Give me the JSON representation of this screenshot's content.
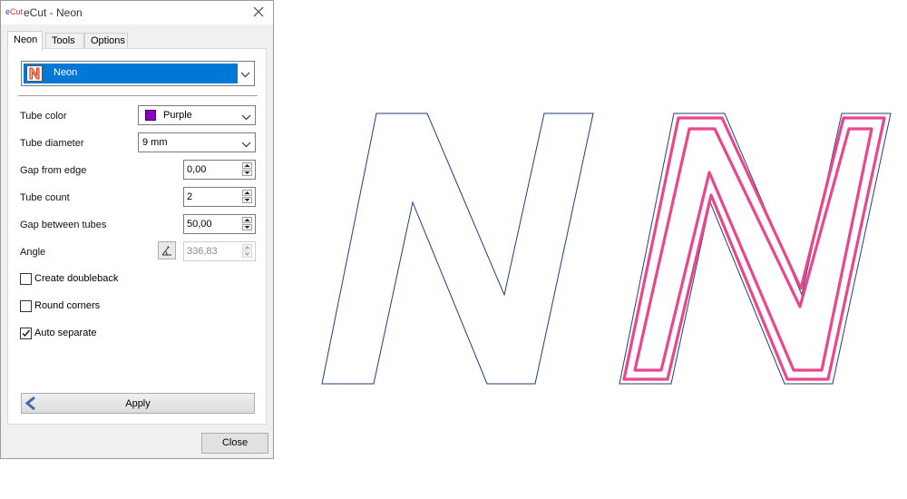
{
  "window": {
    "logo_e": "e",
    "logo_cut": "Cut",
    "title": "eCut - Neon"
  },
  "tabs": [
    {
      "label": "Neon",
      "active": true
    },
    {
      "label": "Tools",
      "active": false
    },
    {
      "label": "Options",
      "active": false
    }
  ],
  "preset": {
    "icon": "neon-n-icon",
    "label": "Neon"
  },
  "fields": {
    "tube_color": {
      "label": "Tube color",
      "value": "Purple",
      "swatch": "#8b00c9"
    },
    "tube_diameter": {
      "label": "Tube diameter",
      "value": "9 mm"
    },
    "gap_from_edge": {
      "label": "Gap from edge",
      "value": "0,00"
    },
    "tube_count": {
      "label": "Tube count",
      "value": "2"
    },
    "gap_between_tubes": {
      "label": "Gap between tubes",
      "value": "50,00"
    },
    "angle": {
      "label": "Angle",
      "value": "336,83",
      "disabled": true
    }
  },
  "checkboxes": {
    "create_doubleback": {
      "label": "Create doubleback",
      "checked": false
    },
    "round_corners": {
      "label": "Round corners",
      "checked": false
    },
    "auto_separate": {
      "label": "Auto separate",
      "checked": true
    }
  },
  "buttons": {
    "apply": "Apply",
    "close": "Close"
  },
  "colors": {
    "selection": "#0078d7",
    "outline": "#1f3f7a",
    "neon_tube": "#e8478b"
  }
}
